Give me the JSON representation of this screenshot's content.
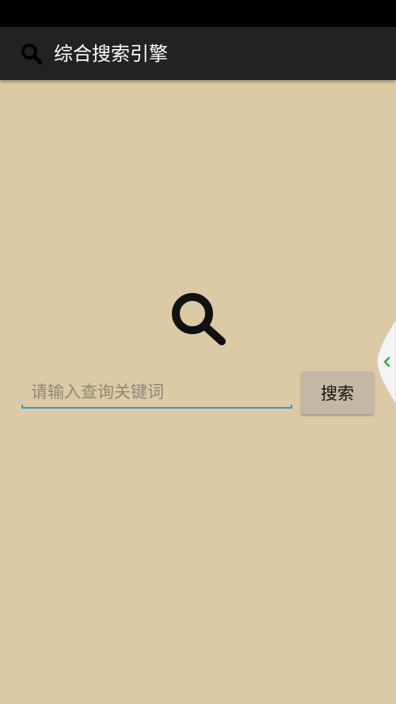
{
  "app_bar": {
    "title": "综合搜索引擎",
    "icon": "search-icon"
  },
  "search": {
    "placeholder": "请输入查询关键词",
    "value": "",
    "button_label": "搜索",
    "hero_icon": "search-icon"
  },
  "side_handle": {
    "icon": "chevron-left-icon"
  },
  "colors": {
    "status_bar": "#000000",
    "app_bar": "#222222",
    "background": "#dcc9a6",
    "input_underline": "#2e9bd3",
    "button_bg": "#c2b8a3",
    "handle_arrow": "#3aa64a"
  }
}
